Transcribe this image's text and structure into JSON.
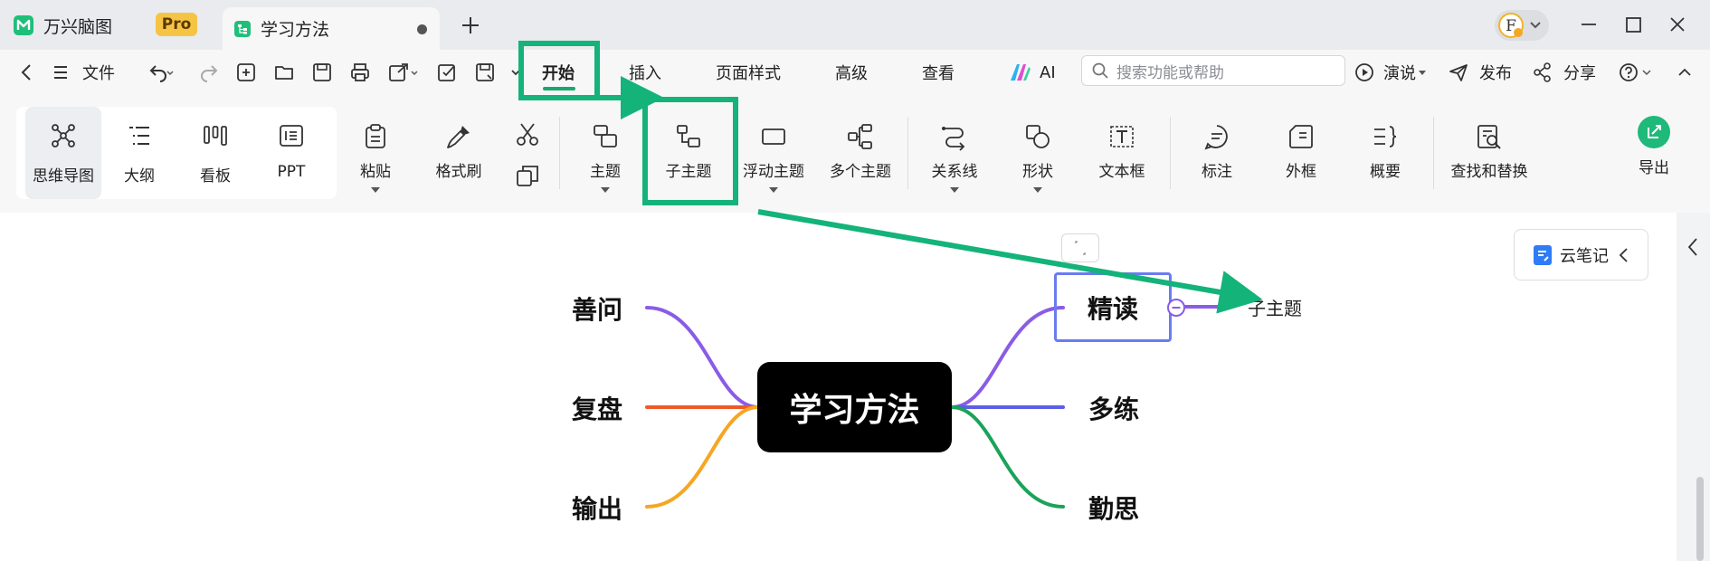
{
  "titlebar": {
    "app_name": "万兴脑图",
    "pro_badge": "Pro",
    "doc_tab_title": "学习方法",
    "new_tab_icon": "plus-icon",
    "avatar_letter": "F"
  },
  "menubar": {
    "file_label": "文件",
    "tabs": [
      "开始",
      "插入",
      "页面样式",
      "高级",
      "查看"
    ],
    "ai_label": "AI",
    "search_placeholder": "搜索功能或帮助",
    "present_label": "演说",
    "publish_label": "发布",
    "share_label": "分享"
  },
  "ribbon": {
    "views": [
      "思维导图",
      "大纲",
      "看板",
      "PPT"
    ],
    "paste": "粘贴",
    "format_painter": "格式刷",
    "topic": "主题",
    "subtopic": "子主题",
    "floating_topic": "浮动主题",
    "multiple_topics": "多个主题",
    "relationship": "关系线",
    "shape": "形状",
    "textbox": "文本框",
    "callout": "标注",
    "boundary": "外框",
    "summary": "概要",
    "find_replace": "查找和替换",
    "export": "导出"
  },
  "mindmap": {
    "central_topic": "学习方法",
    "left_branches": [
      "善问",
      "复盘",
      "输出"
    ],
    "right_branches": [
      "精读",
      "多练",
      "勤思"
    ],
    "new_subtopic": "子主题",
    "branch_colors": {
      "善问": "#8a5ce6",
      "复盘": "#ef5a2a",
      "输出": "#f5a623",
      "精读": "#8a5ce6",
      "多练": "#5b5fe6",
      "勤思": "#1aa35a"
    }
  },
  "side_panel": {
    "cloud_notes_label": "云笔记"
  },
  "colors": {
    "accent_green": "#16a96b",
    "annotation_green": "#13b37a",
    "selection_blue": "#6a7cf0"
  }
}
